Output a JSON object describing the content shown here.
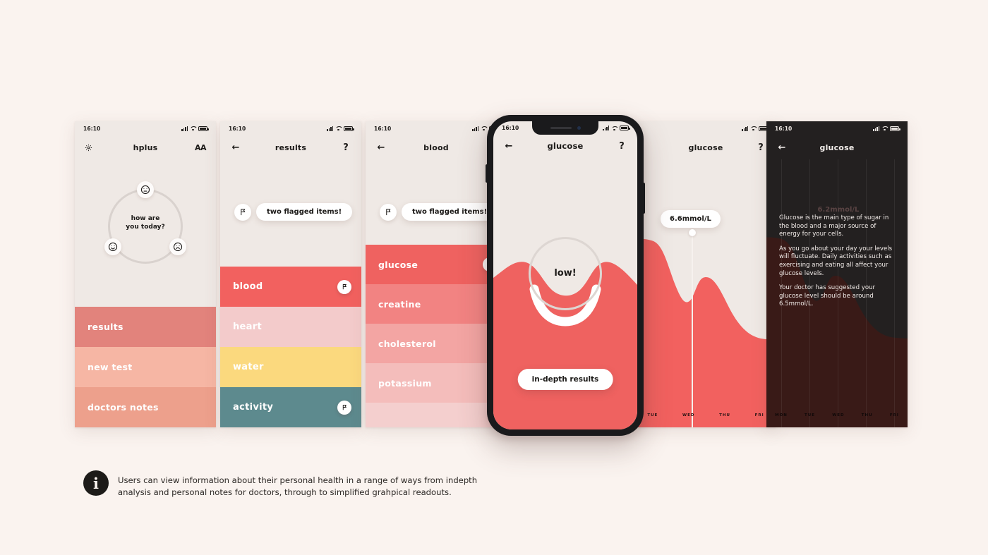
{
  "caption": {
    "icon": "info-icon",
    "text": "Users can view information about their personal health in a range of ways from indepth analysis and personal notes for doctors, through to simplified grahpical readouts."
  },
  "status_bar": {
    "time": "16:10",
    "signal": "signal-bars-icon",
    "wifi": "wifi-icon",
    "battery": "battery-icon"
  },
  "screens": [
    {
      "id": "home",
      "nav": {
        "left_icon": "gear-icon",
        "title": "hplus",
        "right_icon": "AA"
      },
      "mood": {
        "question_line1": "how are",
        "question_line2": "you today?",
        "faces": [
          "neutral-face-icon",
          "happy-face-icon",
          "sad-face-icon"
        ]
      },
      "menu": [
        {
          "label": "results",
          "color": "#e2837c"
        },
        {
          "label": "new test",
          "color": "#f6b6a4"
        },
        {
          "label": "doctors notes",
          "color": "#eda08c"
        }
      ]
    },
    {
      "id": "results",
      "nav": {
        "left_icon": "back-arrow-icon",
        "title": "results",
        "right_icon": "?"
      },
      "toast": {
        "icon": "flag-icon",
        "text": "two flagged items!"
      },
      "categories": [
        {
          "label": "blood",
          "color": "#f2615f",
          "flagged": true
        },
        {
          "label": "heart",
          "color": "#f3cbcb",
          "flagged": false
        },
        {
          "label": "water",
          "color": "#fbd97e",
          "flagged": false
        },
        {
          "label": "activity",
          "color": "#5d8a8e",
          "flagged": true
        }
      ]
    },
    {
      "id": "blood",
      "nav": {
        "left_icon": "back-arrow-icon",
        "title": "blood",
        "right_icon": ""
      },
      "toast": {
        "icon": "flag-icon",
        "text": "two flagged items!"
      },
      "items": [
        {
          "label": "glucose",
          "color": "#ef6260",
          "flagged": true
        },
        {
          "label": "creatine",
          "color": "#f28382"
        },
        {
          "label": "cholesterol",
          "color": "#f3a5a3"
        },
        {
          "label": "potassium",
          "color": "#f4bdbb"
        },
        {
          "label": "",
          "color": "#f4cfce"
        }
      ]
    },
    {
      "id": "glucose-hero",
      "nav": {
        "left_icon": "back-arrow-icon",
        "title": "glucose",
        "right_icon": "?"
      },
      "status_label": "low!",
      "cta": "in-depth results"
    },
    {
      "id": "glucose-chart",
      "nav": {
        "left_icon": "",
        "title": "glucose",
        "right_icon": "?"
      },
      "value_pill": "6.6mmol/L"
    },
    {
      "id": "glucose-info",
      "nav": {
        "left_icon": "back-arrow-icon",
        "title": "glucose",
        "right_icon": ""
      },
      "value": "6.2mmol/L",
      "paragraphs": [
        "Glucose is the main type of sugar in the blood and a major source of energy for your cells.",
        "As you go about your day your levels will fluctuate. Daily activities such as exercising and eating all affect your glucose levels.",
        "Your doctor has suggested your glucose level should be around 6.5mmol/L."
      ]
    }
  ],
  "chart_data": {
    "type": "area",
    "title": "glucose",
    "categories": [
      "MON",
      "TUE",
      "WED",
      "THU",
      "FRI"
    ],
    "values": [
      7.8,
      7.4,
      6.6,
      5.3,
      5.0
    ],
    "highlight": {
      "category": "WED",
      "value": 6.6,
      "label": "6.6mmol/L"
    },
    "unit": "mmol/L",
    "ylabel": "",
    "xlabel": "",
    "grid": true,
    "legend": "none",
    "series_color": "#f2615f"
  },
  "colors": {
    "background": "#faf3ef",
    "screen_bg": "#efe9e5",
    "dark_screen_bg": "#232020",
    "coral": "#f2615f",
    "yellow": "#fbd97e",
    "teal": "#5d8a8e",
    "ink": "#1c1a18"
  }
}
